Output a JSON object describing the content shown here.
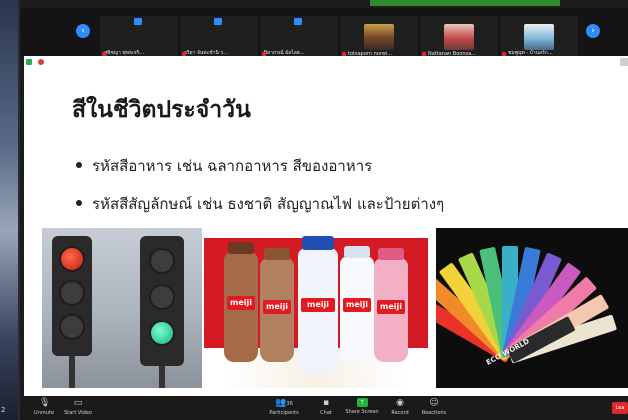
{
  "desktop": {
    "corner_label": "2"
  },
  "participants": {
    "prev_icon": "chevron-left-icon",
    "next_icon": "chevron-right-icon",
    "tiles": [
      {
        "name": "สุพิชญา พุทธเจริ...",
        "video": false
      },
      {
        "name": "จริยา จันทะชำนิ ร...",
        "video": false
      },
      {
        "name": "ปิยาภรณ์ อัลไลฮ...",
        "video": false
      },
      {
        "name": "totsaporn norwi...",
        "video": true
      },
      {
        "name": "Nattanan Boonsa...",
        "video": true
      },
      {
        "name": "ชมพูนุท - บ้านอรัก...",
        "video": true
      }
    ]
  },
  "slide": {
    "title": "สีในชีวิตประจำวัน",
    "bullets": [
      "รหัสสีอาหาร เช่น ฉลากอาหาร สีของอาหาร",
      "รหัสสีสัญลักษณ์ เช่น ธงชาติ สัญญาณไฟ และป้ายต่างๆ"
    ],
    "images": {
      "traffic_lights": "traffic-lights-photo",
      "milk": {
        "brand": "meiji"
      },
      "fan_deck": {
        "label": "ECO WORLD"
      }
    }
  },
  "toolbar": {
    "items": [
      {
        "label": "Unmute",
        "icon": "mic-muted-icon"
      },
      {
        "label": "Start Video",
        "icon": "video-off-icon"
      },
      {
        "label": "Participants",
        "icon": "participants-icon",
        "count": "36"
      },
      {
        "label": "Chat",
        "icon": "chat-icon"
      },
      {
        "label": "Share Screen",
        "icon": "share-screen-icon"
      },
      {
        "label": "Record",
        "icon": "record-icon"
      },
      {
        "label": "Reactions",
        "icon": "reactions-icon"
      }
    ],
    "end_label": "Lea"
  },
  "colors": {
    "zoom_blue": "#2d8cff",
    "share_green": "#23b03e",
    "end_red": "#e02828"
  }
}
